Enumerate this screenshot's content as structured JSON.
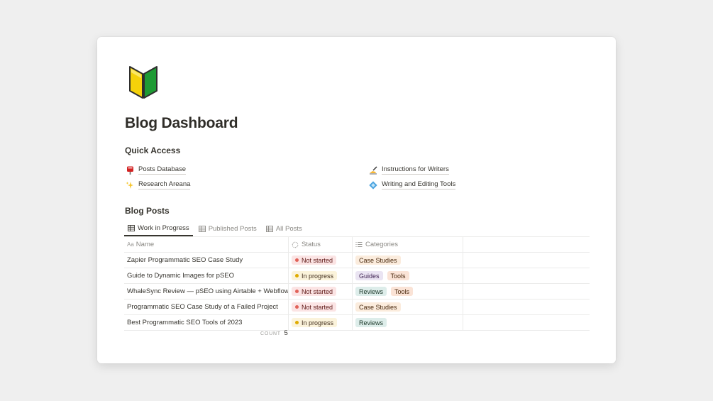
{
  "page": {
    "icon": "beginner-shield-icon",
    "title": "Blog Dashboard"
  },
  "quick_access": {
    "heading": "Quick Access",
    "links": [
      {
        "icon": "postbox-icon",
        "label": "Posts Database"
      },
      {
        "icon": "writing-hand-icon",
        "label": "Instructions for Writers"
      },
      {
        "icon": "sparkles-icon",
        "label": "Research Areana"
      },
      {
        "icon": "diamond-icon",
        "label": "Writing and Editing Tools"
      }
    ]
  },
  "blog_posts": {
    "heading": "Blog Posts",
    "tabs": [
      {
        "label": "Work in Progress",
        "active": true
      },
      {
        "label": "Published Posts",
        "active": false
      },
      {
        "label": "All Posts",
        "active": false
      }
    ],
    "columns": {
      "name": "Name",
      "name_prefix": "Aa",
      "status": "Status",
      "categories": "Categories"
    },
    "rows": [
      {
        "name": "Zapier Programmatic SEO Case Study",
        "status": "Not started",
        "categories": [
          "Case Studies"
        ]
      },
      {
        "name": "Guide to Dynamic Images for pSEO",
        "status": "In progress",
        "categories": [
          "Guides",
          "Tools"
        ]
      },
      {
        "name": "WhaleSync Review — pSEO using Airtable + Webflow",
        "status": "Not started",
        "categories": [
          "Reviews",
          "Tools"
        ]
      },
      {
        "name": "Programmatic SEO Case Study of a Failed Project",
        "status": "Not started",
        "categories": [
          "Case Studies"
        ]
      },
      {
        "name": "Best Programmatic SEO Tools of 2023",
        "status": "In progress",
        "categories": [
          "Reviews"
        ]
      }
    ],
    "count_label": "COUNT",
    "count_value": "5"
  },
  "colors": {
    "background": "#efefef",
    "not_started_bg": "#fbe4e4",
    "not_started_dot": "#e16259",
    "in_progress_bg": "#fbf3db",
    "in_progress_dot": "#dfab01",
    "case_studies_bg": "#fbecdd",
    "tools_bg": "#fae3d6",
    "guides_bg": "#eae4f2",
    "reviews_bg": "#ddedea"
  }
}
